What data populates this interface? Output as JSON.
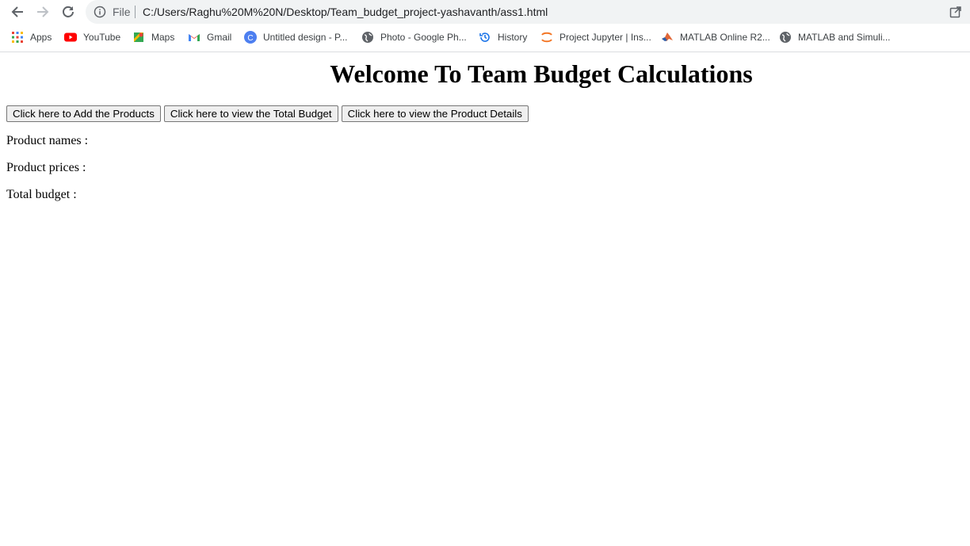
{
  "browser": {
    "file_label": "File",
    "url": "C:/Users/Raghu%20M%20N/Desktop/Team_budget_project-yashavanth/ass1.html",
    "bookmarks": [
      {
        "label": "Apps",
        "icon": "apps-grid-icon"
      },
      {
        "label": "YouTube",
        "icon": "youtube-icon"
      },
      {
        "label": "Maps",
        "icon": "maps-icon"
      },
      {
        "label": "Gmail",
        "icon": "gmail-icon"
      },
      {
        "label": "Untitled design - P...",
        "icon": "canva-icon"
      },
      {
        "label": "Photo - Google Ph...",
        "icon": "globe-icon"
      },
      {
        "label": "History",
        "icon": "history-icon"
      },
      {
        "label": "Project Jupyter | Ins...",
        "icon": "jupyter-icon"
      },
      {
        "label": "MATLAB Online R2...",
        "icon": "matlab-icon"
      },
      {
        "label": "MATLAB and Simuli...",
        "icon": "globe-icon"
      }
    ]
  },
  "page": {
    "title": "Welcome To Team Budget Calculations",
    "buttons": {
      "add_products": "Click here to Add the Products",
      "total_budget": "Click here to view the Total Budget",
      "product_details": "Click here to view the Product Details"
    },
    "product_names_label": "Product names :",
    "product_prices_label": "Product prices :",
    "total_budget_label": "Total budget :"
  },
  "colors": {
    "omnibox_bg": "#f1f3f4",
    "button_bg": "#efefef",
    "youtube_red": "#ff0000"
  }
}
